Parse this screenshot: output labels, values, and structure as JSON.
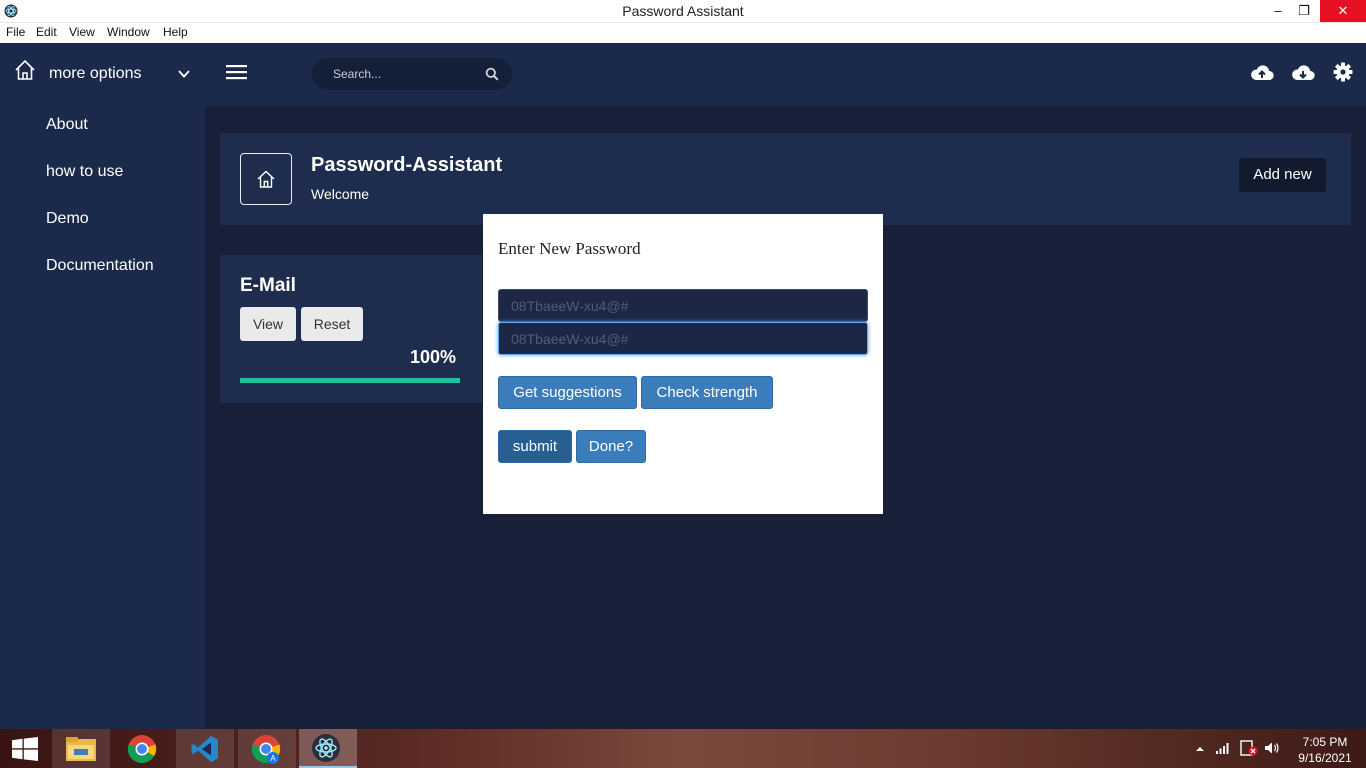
{
  "window": {
    "title": "Password Assistant",
    "minimize": "–",
    "maximize": "❐",
    "close": "✕"
  },
  "menu": [
    "File",
    "Edit",
    "View",
    "Window",
    "Help"
  ],
  "appbar": {
    "more_options": "more options",
    "search_placeholder": "Search..."
  },
  "sidebar": {
    "items": [
      {
        "label": "About"
      },
      {
        "label": "how to use"
      },
      {
        "label": "Demo"
      },
      {
        "label": "Documentation"
      }
    ]
  },
  "header": {
    "title": "Password-Assistant",
    "subtitle": "Welcome",
    "add_new": "Add new"
  },
  "card": {
    "title": "E-Mail",
    "view": "View",
    "reset": "Reset",
    "strength": "100%",
    "strength_fraction": 1.0
  },
  "modal": {
    "title": "Enter New Password",
    "password_placeholder": "08TbaeeW-xu4@#",
    "confirm_placeholder": "08TbaeeW-xu4@#",
    "get_suggestions": "Get suggestions",
    "check_strength": "Check strength",
    "submit": "submit",
    "done": "Done?"
  },
  "taskbar": {
    "time": "7:05 PM",
    "date": "9/16/2021"
  },
  "colors": {
    "accent_green": "#1fc19b",
    "modal_button": "#3b7dbb",
    "close_red": "#e81123"
  }
}
